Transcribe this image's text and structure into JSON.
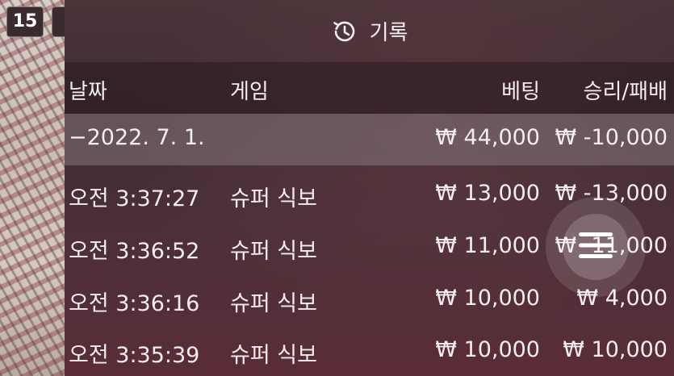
{
  "game_strip": {
    "round_number": "15"
  },
  "panel": {
    "title": "기록",
    "icon": "history-icon",
    "columns": {
      "date": "날짜",
      "game": "게임",
      "bet": "베팅",
      "result": "승리/패배"
    },
    "date_group": {
      "date": "−2022. 7. 1.",
      "bet_total": "₩ 44,000",
      "result_total": "₩ -10,000"
    },
    "rows": [
      {
        "time": "오전 3:37:27",
        "game": "슈퍼 식보",
        "bet": "₩ 13,000",
        "result": "₩ -13,000"
      },
      {
        "time": "오전 3:36:52",
        "game": "슈퍼 식보",
        "bet": "₩ 11,000",
        "result": "₩ -11,000"
      },
      {
        "time": "오전 3:36:16",
        "game": "슈퍼 식보",
        "bet": "₩ 10,000",
        "result": "₩ 4,000"
      },
      {
        "time": "오전 3:35:39",
        "game": "슈퍼 식보",
        "bet": "₩ 10,000",
        "result": "₩ 10,000"
      }
    ]
  },
  "fab": {
    "icon": "menu-icon"
  }
}
